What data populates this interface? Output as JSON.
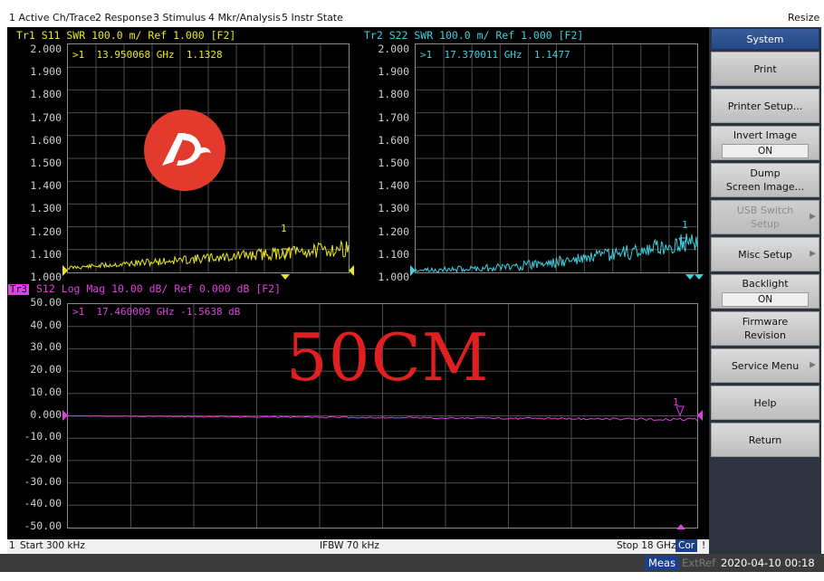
{
  "menubar": {
    "items": [
      "1 Active Ch/Trace",
      "2 Response",
      "3 Stimulus",
      "4 Mkr/Analysis",
      "5 Instr State"
    ],
    "resize": "Resize"
  },
  "trace1": {
    "header": "Tr1 S11 SWR 100.0 m/ Ref 1.000 [F2]",
    "marker_readout": ">1  13.950068 GHz  1.1328",
    "marker_label": "1",
    "ticks": [
      "2.000",
      "1.900",
      "1.800",
      "1.700",
      "1.600",
      "1.500",
      "1.400",
      "1.300",
      "1.200",
      "1.100",
      "1.000"
    ],
    "color": "#e8e820"
  },
  "trace2": {
    "header": "Tr2 S22 SWR 100.0 m/ Ref 1.000 [F2]",
    "marker_readout": ">1  17.370011 GHz  1.1477",
    "marker_label": "1",
    "ticks": [
      "2.000",
      "1.900",
      "1.800",
      "1.700",
      "1.600",
      "1.500",
      "1.400",
      "1.300",
      "1.200",
      "1.100",
      "1.000"
    ],
    "color": "#3fd0e0"
  },
  "trace3": {
    "badge": "Tr3",
    "header": "S12 Log Mag 10.00 dB/ Ref 0.000 dB [F2]",
    "marker_readout": ">1  17.460009 GHz -1.5638 dB",
    "marker_label": "1",
    "ticks": [
      "50.00",
      "40.00",
      "30.00",
      "20.00",
      "10.00",
      "0.000",
      "-10.00",
      "-20.00",
      "-30.00",
      "-40.00",
      "-50.00"
    ],
    "color": "#e040e0"
  },
  "overlay_text": "50CM",
  "status": {
    "channel": "1",
    "start": "Start 300 kHz",
    "ifbw": "IFBW 70 kHz",
    "stop": "Stop 18 GHz",
    "cor": "Cor",
    "meas": "Meas",
    "extref": "ExtRef",
    "datetime": "2020-04-10 00:18"
  },
  "softkeys": {
    "title": "System",
    "print": "Print",
    "printer_setup": "Printer Setup...",
    "invert_image": "Invert Image",
    "invert_image_val": "ON",
    "dump1": "Dump",
    "dump2": "Screen Image...",
    "usb1": "USB Switch",
    "usb2": "Setup",
    "misc_setup": "Misc Setup",
    "backlight": "Backlight",
    "backlight_val": "ON",
    "firmware1": "Firmware",
    "firmware2": "Revision",
    "service_menu": "Service Menu",
    "help": "Help",
    "return": "Return"
  },
  "colors": {
    "screen_bg": "#000000",
    "grid": "#5a5a5a",
    "panel": "#2d3440",
    "overlay_red": "#e02020"
  }
}
